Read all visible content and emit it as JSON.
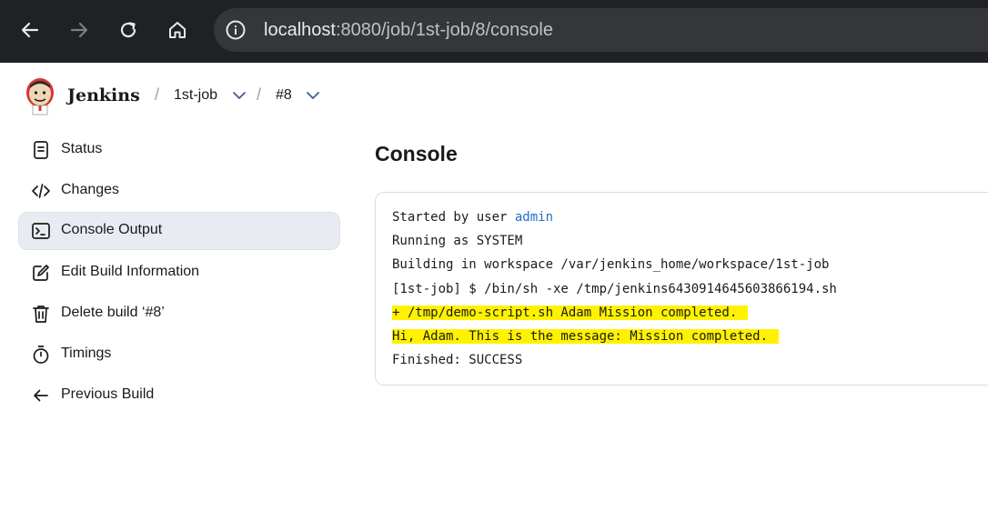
{
  "browser": {
    "url_host": "localhost",
    "url_rest": ":8080/job/1st-job/8/console",
    "icons": [
      "back-icon",
      "forward-icon",
      "reload-icon",
      "home-icon",
      "site-info-icon"
    ]
  },
  "header": {
    "brand": "Jenkins",
    "breadcrumbs": [
      {
        "label": "1st-job"
      },
      {
        "label": "#8"
      }
    ],
    "separator": "/"
  },
  "sidebar": {
    "items": [
      {
        "label": "Status",
        "icon": "status-icon"
      },
      {
        "label": "Changes",
        "icon": "code-icon"
      },
      {
        "label": "Console Output",
        "icon": "terminal-icon",
        "active": true
      },
      {
        "label": "Edit Build Information",
        "icon": "edit-icon"
      },
      {
        "label": "Delete build ‘#8’",
        "icon": "trash-icon"
      },
      {
        "label": "Timings",
        "icon": "stopwatch-icon"
      },
      {
        "label": "Previous Build",
        "icon": "arrow-left-icon"
      }
    ]
  },
  "main": {
    "title": "Console",
    "console": {
      "line1_prefix": "Started by user ",
      "line1_user": "admin",
      "lines": [
        "Running as SYSTEM",
        "Building in workspace /var/jenkins_home/workspace/1st-job",
        "[1st-job] $ /bin/sh -xe /tmp/jenkins6430914645603866194.sh",
        "+ /tmp/demo-script.sh Adam Mission completed.",
        "Hi, Adam. This is the message: Mission completed.",
        "Finished: SUCCESS"
      ],
      "highlight_color": "#fff200"
    }
  }
}
